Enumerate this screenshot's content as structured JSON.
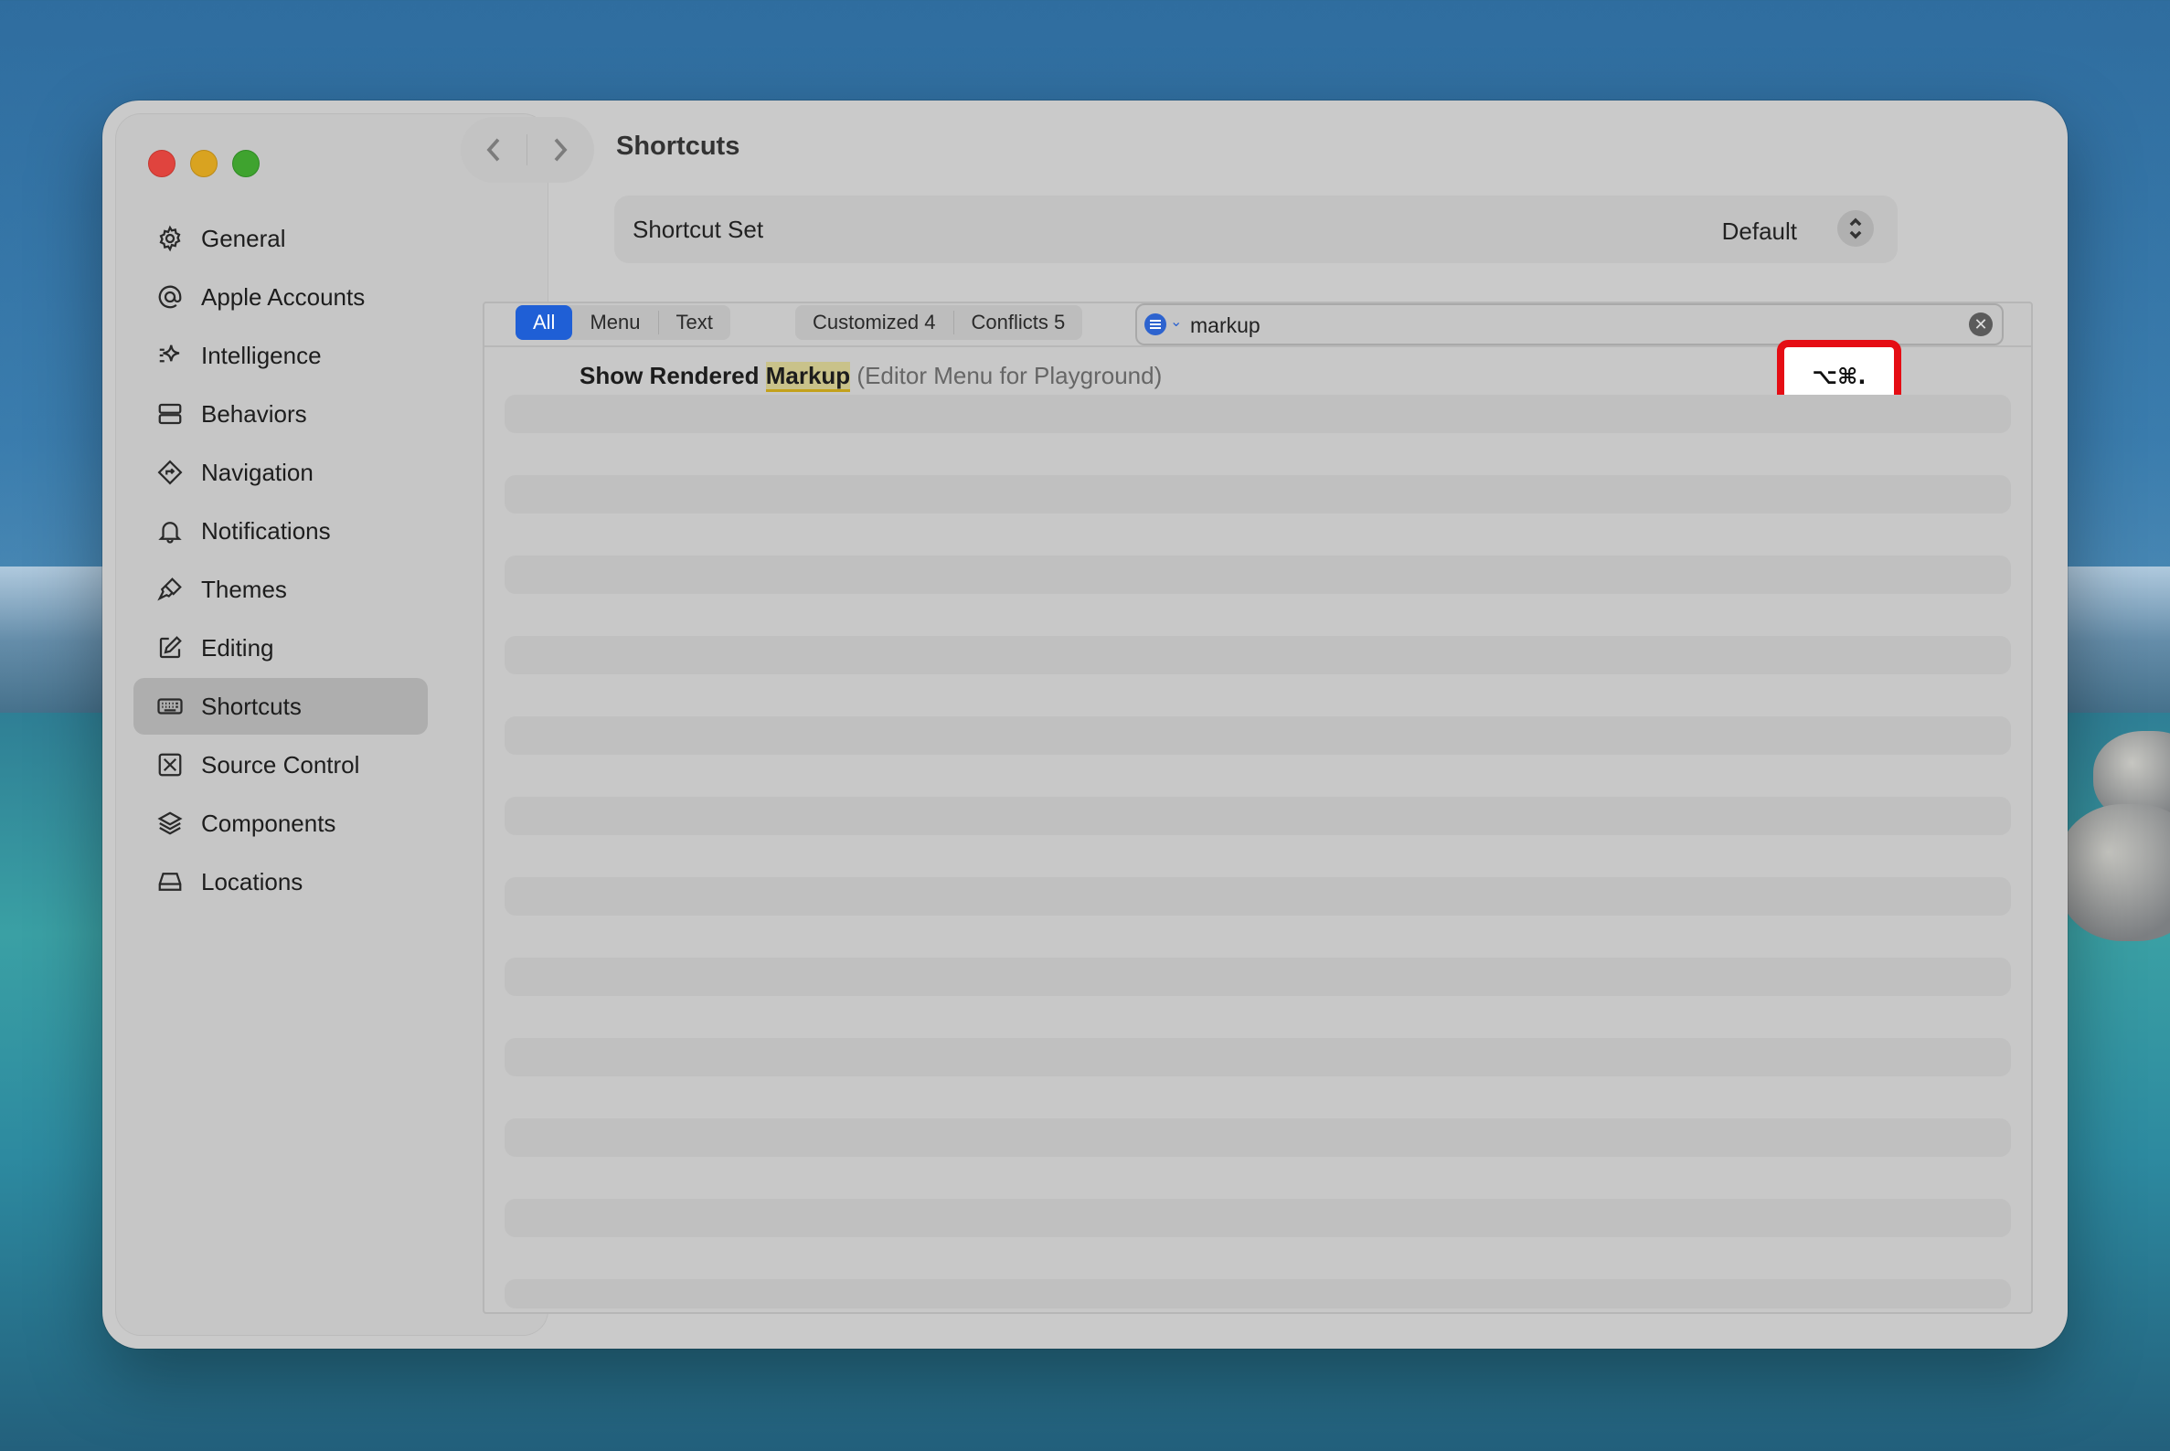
{
  "window": {
    "title": "Shortcuts",
    "shortcut_set_label": "Shortcut Set",
    "shortcut_set_value": "Default"
  },
  "sidebar": {
    "items": [
      {
        "label": "General",
        "icon": "gear-icon"
      },
      {
        "label": "Apple Accounts",
        "icon": "at-icon"
      },
      {
        "label": "Intelligence",
        "icon": "sparkle-icon"
      },
      {
        "label": "Behaviors",
        "icon": "behaviors-icon"
      },
      {
        "label": "Navigation",
        "icon": "navigation-icon"
      },
      {
        "label": "Notifications",
        "icon": "bell-icon"
      },
      {
        "label": "Themes",
        "icon": "paintbrush-icon"
      },
      {
        "label": "Editing",
        "icon": "edit-icon"
      },
      {
        "label": "Shortcuts",
        "icon": "keyboard-icon",
        "active": true
      },
      {
        "label": "Source Control",
        "icon": "source-control-icon"
      },
      {
        "label": "Components",
        "icon": "layers-icon"
      },
      {
        "label": "Locations",
        "icon": "drive-icon"
      }
    ]
  },
  "filters": {
    "all": "All",
    "menu": "Menu",
    "text": "Text",
    "customized": "Customized 4",
    "conflicts": "Conflicts 5"
  },
  "search": {
    "value": "markup"
  },
  "results": [
    {
      "title_prefix": "Show Rendered ",
      "title_match": "Markup",
      "context": "(Editor Menu for Playground)",
      "shortcut": "⌥⌘."
    }
  ]
}
